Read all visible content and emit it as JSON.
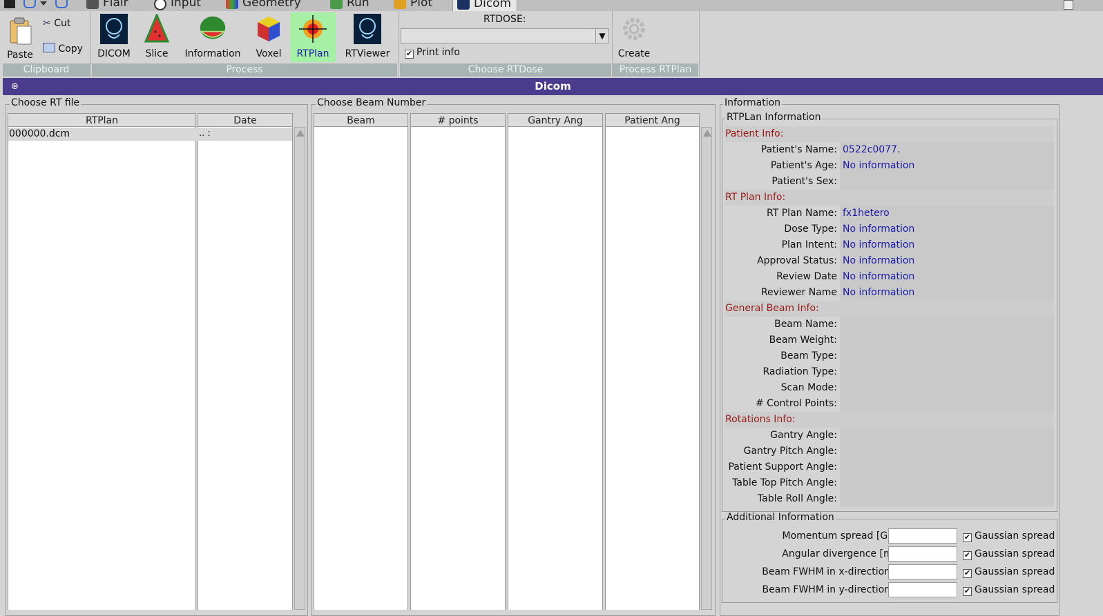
{
  "tabs": [
    {
      "label": "Flair"
    },
    {
      "label": "Input"
    },
    {
      "label": "Geometry"
    },
    {
      "label": "Run"
    },
    {
      "label": "Plot"
    },
    {
      "label": "Dicom",
      "active": true
    }
  ],
  "ribbon": {
    "clipboard": {
      "paste": "Paste",
      "cut": "Cut",
      "copy": "Copy",
      "group": "Clipboard"
    },
    "process": {
      "dicom": "DICOM",
      "slice": "Slice",
      "information": "Information",
      "voxel": "Voxel",
      "rtplan": "RTPlan",
      "rtviewer": "RTViewer",
      "group": "Process"
    },
    "rtdose": {
      "label": "RTDOSE:",
      "value": "",
      "print_info": "Print info",
      "print_info_checked": true,
      "group": "Choose RTDose"
    },
    "process_rtplan": {
      "create": "Create",
      "group": "Process RTPlan"
    }
  },
  "window": {
    "title": "Dicom",
    "close_icon": "⊛"
  },
  "rtfile": {
    "frame_title": "Choose RT file",
    "columns": [
      "RTPlan",
      "Date"
    ],
    "rows": [
      {
        "file": "000000.dcm",
        "date": ".. :"
      }
    ]
  },
  "beams": {
    "frame_title": "Choose Beam Number",
    "columns": [
      "Beam",
      "# points",
      "Gantry Ang",
      "Patient Ang"
    ]
  },
  "info": {
    "frame_title": "Information",
    "rtplan_title": "RTPLan Information",
    "sections": {
      "patient": "Patient Info:",
      "rtplan": "RT Plan Info:",
      "beam": "General Beam Info:",
      "rotations": "Rotations Info:"
    },
    "patient_name": {
      "label": "Patient's Name:",
      "value": "0522c0077."
    },
    "patient_age": {
      "label": "Patient's Age:",
      "value": "No information"
    },
    "patient_sex": {
      "label": "Patient's Sex:",
      "value": ""
    },
    "plan_name": {
      "label": "RT Plan Name:",
      "value": "fx1hetero"
    },
    "dose_type": {
      "label": "Dose Type:",
      "value": "No information"
    },
    "plan_intent": {
      "label": "Plan Intent:",
      "value": "No information"
    },
    "approval": {
      "label": "Approval Status:",
      "value": "No information"
    },
    "review_date": {
      "label": "Review Date",
      "value": "No information"
    },
    "reviewer": {
      "label": "Reviewer Name",
      "value": "No information"
    },
    "beam_name": {
      "label": "Beam Name:",
      "value": ""
    },
    "beam_weight": {
      "label": "Beam Weight:",
      "value": ""
    },
    "beam_type": {
      "label": "Beam Type:",
      "value": ""
    },
    "radiation_type": {
      "label": "Radiation Type:",
      "value": ""
    },
    "scan_mode": {
      "label": "Scan Mode:",
      "value": ""
    },
    "control_points": {
      "label": "# Control Points:",
      "value": ""
    },
    "gantry_angle": {
      "label": "Gantry Angle:",
      "value": ""
    },
    "gantry_pitch": {
      "label": "Gantry Pitch Angle:",
      "value": ""
    },
    "patient_support": {
      "label": "Patient Support Angle:",
      "value": ""
    },
    "table_top_pitch": {
      "label": "Table Top Pitch Angle:",
      "value": ""
    },
    "table_roll": {
      "label": "Table Roll Angle:",
      "value": ""
    }
  },
  "additional": {
    "title": "Additional Information",
    "gaussian": "Gaussian spread",
    "rows": [
      {
        "label": "Momentum spread [GeV/c]:",
        "value": "",
        "gaussian": true
      },
      {
        "label": "Angular divergence [mrad]:",
        "value": "",
        "gaussian": true
      },
      {
        "label": "Beam FWHM in x-direction[cm]:",
        "value": "",
        "gaussian": true
      },
      {
        "label": "Beam FWHM in y-direction[cm]:",
        "value": "",
        "gaussian": true
      }
    ]
  },
  "colors": {
    "title_bar": "#4a3b8c",
    "section_label": "#9a1a1a",
    "value_text": "#1b1ba8",
    "group_label_bg": "#a8b4b4"
  }
}
